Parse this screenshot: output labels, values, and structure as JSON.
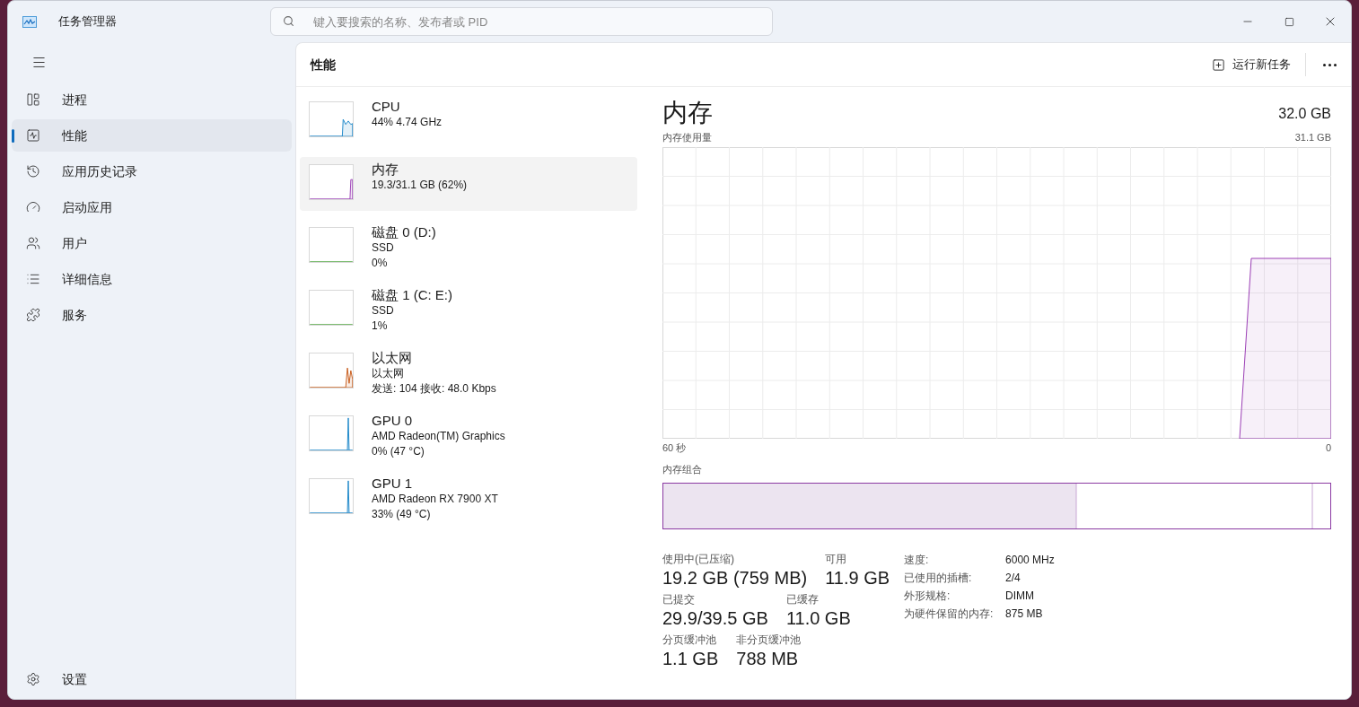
{
  "window": {
    "title": "任务管理器"
  },
  "search": {
    "placeholder": "键入要搜索的名称、发布者或 PID"
  },
  "nav": [
    {
      "label": "进程",
      "kind": "processes",
      "selected": false
    },
    {
      "label": "性能",
      "kind": "performance",
      "selected": true
    },
    {
      "label": "应用历史记录",
      "kind": "history",
      "selected": false
    },
    {
      "label": "启动应用",
      "kind": "startup",
      "selected": false
    },
    {
      "label": "用户",
      "kind": "users",
      "selected": false
    },
    {
      "label": "详细信息",
      "kind": "details",
      "selected": false
    },
    {
      "label": "服务",
      "kind": "services",
      "selected": false
    }
  ],
  "settings": {
    "label": "设置"
  },
  "page": {
    "title": "性能",
    "run_task": "运行新任务"
  },
  "resources": [
    {
      "name": "CPU",
      "lines": [
        "44% 4.74 GHz"
      ],
      "kind": "cpu",
      "selected": false
    },
    {
      "name": "内存",
      "lines": [
        "19.3/31.1 GB (62%)"
      ],
      "kind": "memory",
      "selected": true
    },
    {
      "name": "磁盘 0 (D:)",
      "lines": [
        "SSD",
        "0%"
      ],
      "kind": "disk",
      "selected": false
    },
    {
      "name": "磁盘 1 (C: E:)",
      "lines": [
        "SSD",
        "1%"
      ],
      "kind": "disk",
      "selected": false
    },
    {
      "name": "以太网",
      "lines": [
        "以太网",
        "发送: 104 接收: 48.0 Kbps"
      ],
      "kind": "network",
      "selected": false
    },
    {
      "name": "GPU 0",
      "lines": [
        "AMD Radeon(TM) Graphics",
        "0% (47 °C)"
      ],
      "kind": "gpu",
      "selected": false
    },
    {
      "name": "GPU 1",
      "lines": [
        "AMD Radeon RX 7900 XT",
        "33% (49 °C)"
      ],
      "kind": "gpu",
      "selected": false
    }
  ],
  "detail": {
    "title": "内存",
    "total": "32.0 GB",
    "graph_label": "内存使用量",
    "graph_max": "31.1 GB",
    "x_start": "60 秒",
    "x_end": "0",
    "composition_label": "内存组合",
    "stat_rows": [
      [
        {
          "label": "使用中(已压缩)",
          "value": "19.2 GB (759 MB)"
        },
        {
          "label": "可用",
          "value": "11.9 GB"
        }
      ],
      [
        {
          "label": "已提交",
          "value": "29.9/39.5 GB"
        },
        {
          "label": "已缓存",
          "value": "11.0 GB"
        }
      ],
      [
        {
          "label": "分页缓冲池",
          "value": "1.1 GB"
        },
        {
          "label": "非分页缓冲池",
          "value": "788 MB"
        }
      ]
    ],
    "specs": [
      {
        "label": "速度:",
        "value": "6000 MHz"
      },
      {
        "label": "已使用的插槽:",
        "value": "2/4"
      },
      {
        "label": "外形规格:",
        "value": "DIMM"
      },
      {
        "label": "为硬件保留的内存:",
        "value": "875 MB"
      }
    ]
  }
}
